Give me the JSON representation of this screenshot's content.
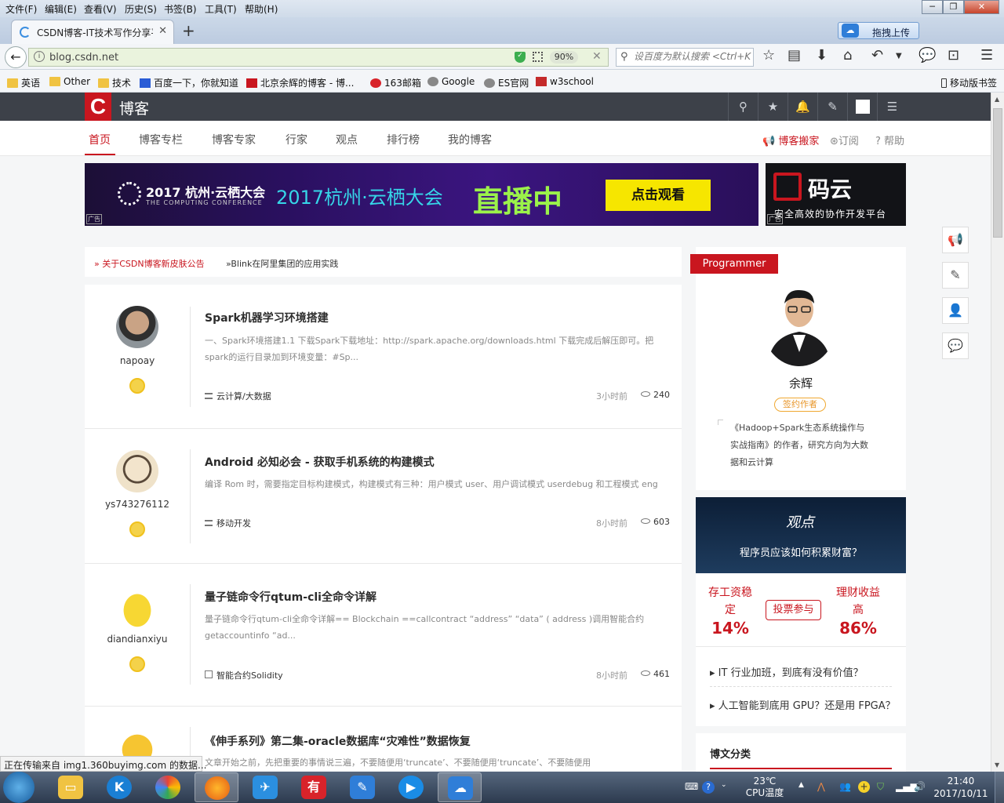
{
  "browser": {
    "menu": [
      "文件(F)",
      "编辑(E)",
      "查看(V)",
      "历史(S)",
      "书签(B)",
      "工具(T)",
      "帮助(H)"
    ],
    "tab_title": "CSDN博客-IT技术写作分享平",
    "new_tab": "+",
    "baidu_upload": "拖拽上传",
    "url": "blog.csdn.net",
    "zoom": "90%",
    "search_placeholder": "设百度为默认搜索 <Ctrl+K",
    "bookmarks": [
      "英语",
      "Other",
      "技术",
      "百度一下，你就知道",
      "北京余辉的博客 - 博...",
      "163邮箱",
      "Google",
      "ES官网",
      "w3school"
    ],
    "mobile_bookmarks": "移动版书签",
    "status": "正在传输来自 img1.360buyimg.com 的数据..."
  },
  "site": {
    "logo": "C",
    "title": "博客",
    "nav": [
      "首页",
      "博客专栏",
      "博客专家",
      "行家",
      "观点",
      "排行榜",
      "我的博客"
    ],
    "nav_right": [
      "博客搬家",
      "订阅",
      "帮助"
    ],
    "banner1": {
      "event": "2017 杭州·云栖大会",
      "sub": "THE COMPUTING CONFERENCE",
      "headline": "2017杭州·云栖大会",
      "live": "直播中",
      "cta": "点击观看",
      "ad": "广告"
    },
    "banner2": {
      "brand": "码云",
      "slogan": "安全高效的协作开发平台",
      "ad": "广告"
    },
    "notices": [
      "» 关于CSDN博客新皮肤公告",
      "»Blink在阿里集团的应用实践"
    ]
  },
  "articles": [
    {
      "user": "napoay",
      "title": "Spark机器学习环境搭建",
      "desc": "一、Spark环境搭建1.1 下载Spark下载地址：http://spark.apache.org/downloads.html 下载完成后解压即可。把spark的运行目录加到环境变量：#Sp...",
      "category": "云计算/大数据",
      "time": "3小时前",
      "views": "240"
    },
    {
      "user": "ys743276112",
      "title": "Android 必知必会 - 获取手机系统的构建模式",
      "desc": "编译 Rom 时，需要指定目标构建模式，构建模式有三种：用户模式 user、用户调试模式 userdebug 和工程模式 eng",
      "category": "移动开发",
      "time": "8小时前",
      "views": "603"
    },
    {
      "user": "diandianxiyu",
      "title": "量子链命令行qtum-cli全命令详解",
      "desc": "量子链命令行qtum-cli全命令详解== Blockchain ==callcontract  “address”  “data”  ( address )调用智能合约getaccountinfo  “ad...",
      "category": "智能合约Solidity",
      "time": "8小时前",
      "views": "461"
    },
    {
      "user": "",
      "title": "《伸手系列》第二集-oracle数据库“灾难性”数据恢复",
      "desc": "文章开始之前，先把重要的事情说三遍，不要随便用‘truncate’、不要随便用‘truncate’、不要随便用",
      "category": "",
      "time": "",
      "views": ""
    }
  ],
  "sidebar": {
    "programmer_tag": "Programmer",
    "name": "余辉",
    "badge": "签约作者",
    "desc": "《Hadoop+Spark生态系统操作与实战指南》的作者，研究方向为大数据和云计算",
    "viewpoint_logo": "观点",
    "question": "程序员应该如何积累财富？",
    "option_left": "存工资稳定",
    "pct_left": "14%",
    "vote": "投票参与",
    "option_right": "理财收益高",
    "pct_right": "86%",
    "links": [
      "IT 行业加班，到底有没有价值？",
      "人工智能到底用 GPU？还是用 FPGA？"
    ],
    "category_title": "博文分类"
  },
  "taskbar": {
    "temp": "23℃",
    "temp_label": "CPU温度",
    "time": "21:40",
    "date": "2017/10/11"
  },
  "colors": {
    "brand_red": "#c9161f",
    "header_dark": "#3d4149",
    "link_gray": "#888888"
  }
}
